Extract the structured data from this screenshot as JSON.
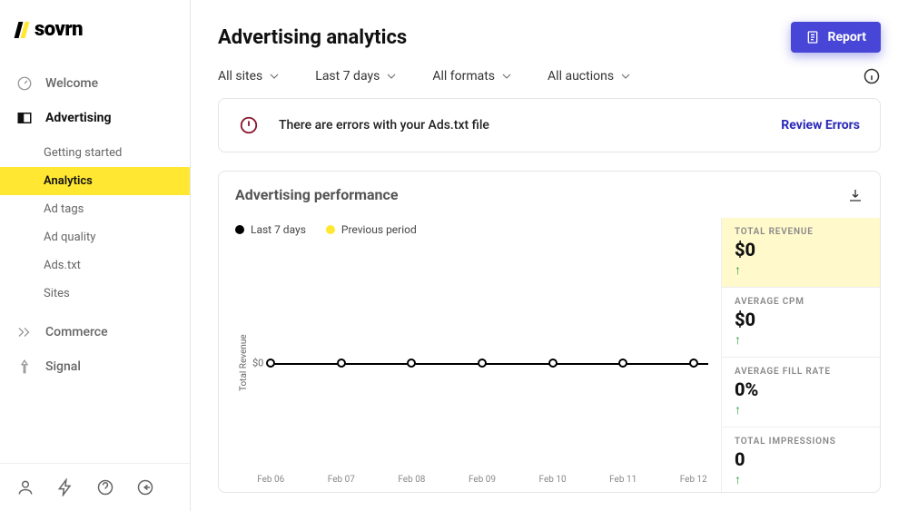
{
  "brand": "sovrn",
  "sidebar": {
    "items": [
      {
        "label": "Welcome"
      },
      {
        "label": "Advertising"
      },
      {
        "label": "Commerce"
      },
      {
        "label": "Signal"
      }
    ],
    "sub": [
      {
        "label": "Getting started"
      },
      {
        "label": "Analytics"
      },
      {
        "label": "Ad tags"
      },
      {
        "label": "Ad quality"
      },
      {
        "label": "Ads.txt"
      },
      {
        "label": "Sites"
      }
    ]
  },
  "page": {
    "title": "Advertising analytics",
    "report_btn": "Report"
  },
  "filters": [
    {
      "label": "All sites"
    },
    {
      "label": "Last 7 days"
    },
    {
      "label": "All formats"
    },
    {
      "label": "All auctions"
    }
  ],
  "alert": {
    "text": "There are errors with your Ads.txt file",
    "action": "Review Errors"
  },
  "panel": {
    "title": "Advertising performance",
    "legend": {
      "current": "Last 7 days",
      "previous": "Previous period"
    }
  },
  "chart_data": {
    "type": "line",
    "ylabel": "Total Revenue",
    "ytick": "$0",
    "categories": [
      "Feb 06",
      "Feb 07",
      "Feb 08",
      "Feb 09",
      "Feb 10",
      "Feb 11",
      "Feb 12"
    ],
    "series": [
      {
        "name": "Last 7 days",
        "values": [
          0,
          0,
          0,
          0,
          0,
          0,
          0
        ]
      },
      {
        "name": "Previous period",
        "values": [
          0,
          0,
          0,
          0,
          0,
          0,
          0
        ]
      }
    ],
    "ylim": [
      0,
      0
    ]
  },
  "stats": [
    {
      "label": "TOTAL REVENUE",
      "value": "$0",
      "trend": "up",
      "highlight": true
    },
    {
      "label": "AVERAGE CPM",
      "value": "$0",
      "trend": "up"
    },
    {
      "label": "AVERAGE FILL RATE",
      "value": "0%",
      "trend": "up"
    },
    {
      "label": "TOTAL IMPRESSIONS",
      "value": "0",
      "trend": "up"
    }
  ]
}
